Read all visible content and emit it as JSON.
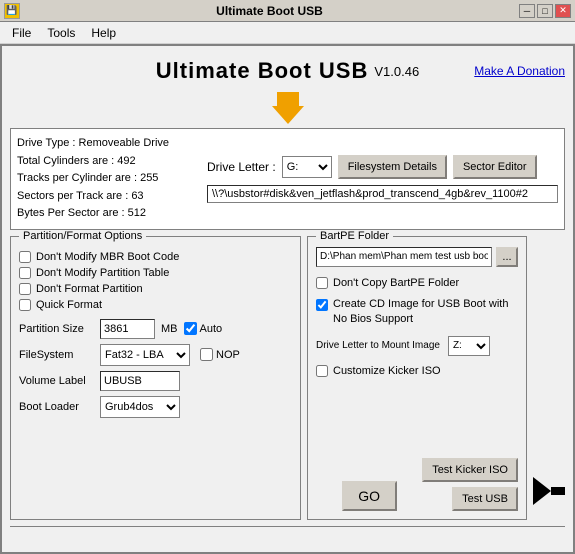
{
  "titlebar": {
    "icon": "💾",
    "title": "Ultimate Boot USB",
    "minimize_label": "─",
    "restore_label": "□",
    "close_label": "✕"
  },
  "menubar": {
    "items": [
      "File",
      "Tools",
      "Help"
    ]
  },
  "header": {
    "title": "Ultimate Boot USB",
    "version": "V1.0.46",
    "donate_label": "Make A Donation"
  },
  "drive_panel": {
    "info_lines": [
      "Drive Type  : Removeable Drive",
      "Total Cylinders are   : 492",
      "Tracks per Cylinder are : 255",
      "Sectors per Track are : 63",
      "Bytes Per Sector are   : 512"
    ],
    "drive_letter_label": "Drive Letter :",
    "drive_letter_value": "G:",
    "filesystem_btn": "Filesystem Details",
    "sector_btn": "Sector Editor",
    "drive_path": "\\\\?\\usbstor#disk&ven_jetflash&prod_transcend_4gb&rev_1100#2"
  },
  "partition_panel": {
    "legend": "Partition/Format Options",
    "checkboxes": [
      {
        "label": "Don't Modify MBR Boot Code",
        "checked": false
      },
      {
        "label": "Don't Modify Partition Table",
        "checked": false
      },
      {
        "label": "Don't Format Partition",
        "checked": false
      },
      {
        "label": "Quick Format",
        "checked": false
      }
    ],
    "partition_size_label": "Partition Size",
    "partition_size_value": "3861",
    "partition_size_unit": "MB",
    "auto_label": "Auto",
    "auto_checked": true,
    "filesystem_label": "FileSystem",
    "filesystem_value": "Fat32 - LBA",
    "nop_label": "NOP",
    "nop_checked": false,
    "volume_label": "Volume Label",
    "volume_value": "UBUSB",
    "bootloader_label": "Boot Loader",
    "bootloader_value": "Grub4dos"
  },
  "bartpe_panel": {
    "legend": "BartPE Folder",
    "path_value": "D:\\Phan mem\\Phan mem test usb boo",
    "browse_label": "...",
    "dont_copy_label": "Don't Copy BartPE Folder",
    "dont_copy_checked": false,
    "create_cd_label": "Create CD Image for USB Boot with No Bios Support",
    "create_cd_checked": true,
    "mount_label": "Drive Letter to Mount Image",
    "mount_value": "Z:",
    "customize_label": "Customize Kicker ISO",
    "customize_checked": false,
    "go_label": "GO",
    "test_kicker_label": "Test Kicker ISO",
    "test_usb_label": "Test USB"
  },
  "status_bar": {
    "text": ""
  }
}
